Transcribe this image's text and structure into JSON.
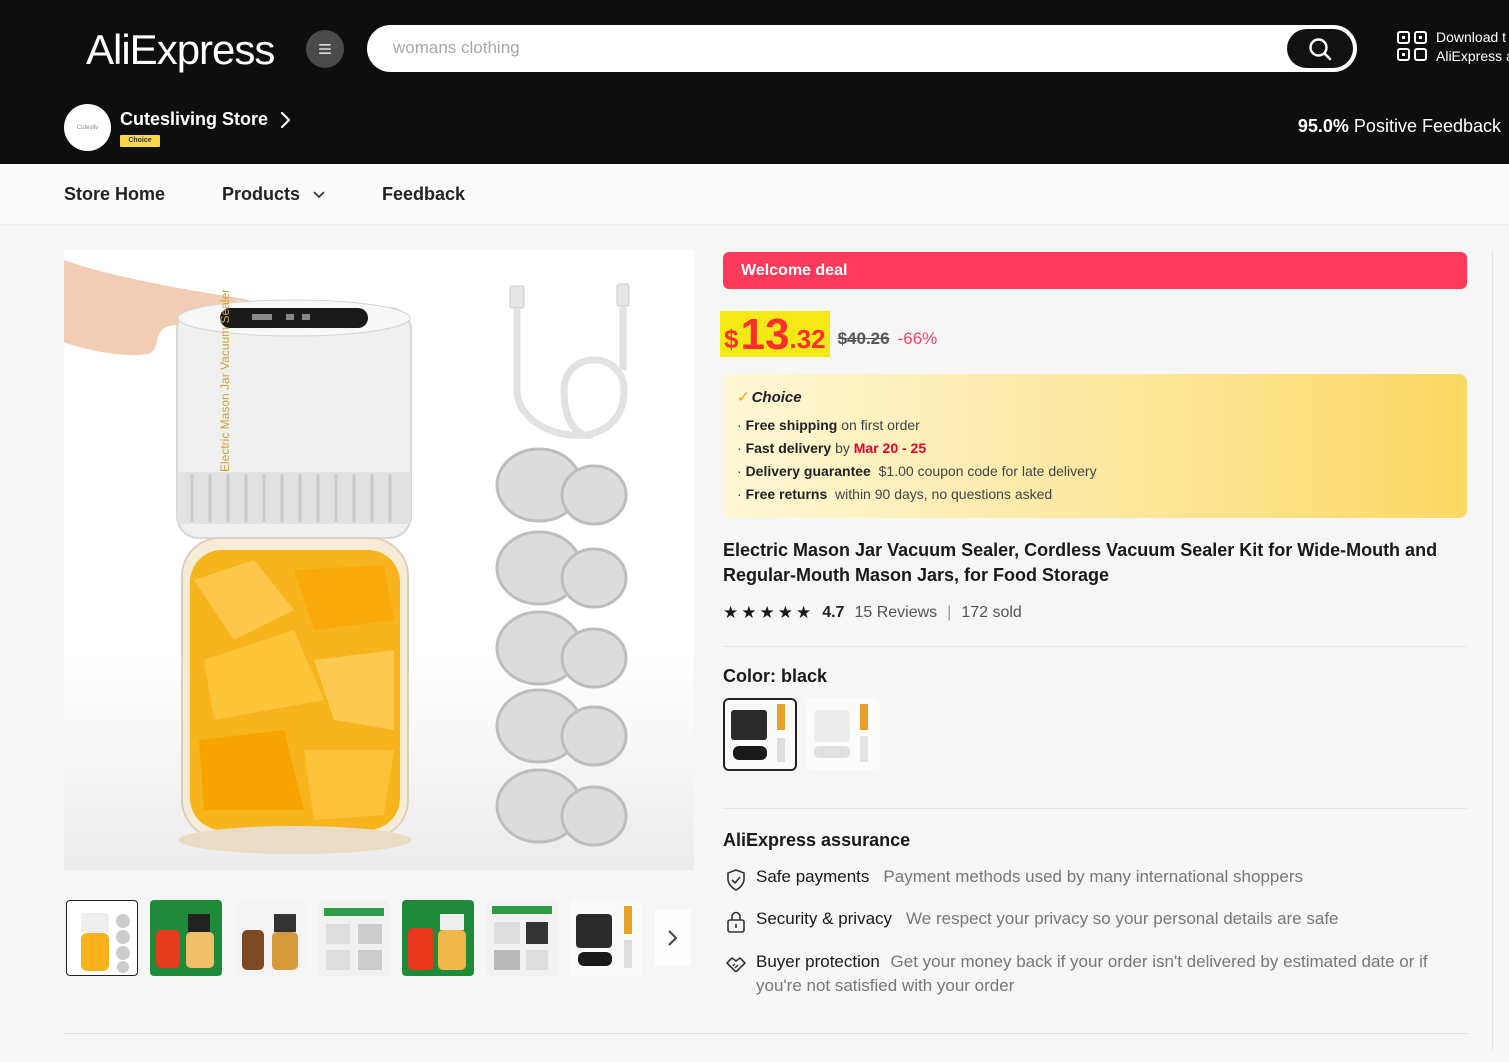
{
  "header": {
    "logo": "AliExpress",
    "search_placeholder": "womans clothing",
    "download_line1": "Download t",
    "download_line2": "AliExpress a"
  },
  "store": {
    "avatar_text": "Cutesliv",
    "name": "Cutesliving Store",
    "badge": "Choice",
    "feedback_value": "95.0%",
    "feedback_label": "Positive Feedback"
  },
  "nav": {
    "items": [
      "Store Home",
      "Products",
      "Feedback"
    ]
  },
  "deal": {
    "banner": "Welcome deal",
    "currency": "$",
    "price_int": "13",
    "price_dec": ".32",
    "original": "$40.26",
    "discount": "-66%"
  },
  "choice": {
    "title": "Choice",
    "lines": [
      {
        "bold": "Free shipping",
        "text": "on first order"
      },
      {
        "bold": "Fast delivery",
        "text": "by",
        "highlight": "Mar 20 - 25"
      },
      {
        "bold": "Delivery guarantee",
        "text": "$1.00 coupon code for late delivery"
      },
      {
        "bold": "Free returns",
        "text": "within 90 days, no questions asked"
      }
    ]
  },
  "product": {
    "title": "Electric Mason Jar Vacuum Sealer, Cordless Vacuum Sealer Kit for Wide-Mouth and Regular-Mouth Mason Jars, for Food Storage",
    "stars": "★★★★★",
    "rating": "4.7",
    "reviews": "15 Reviews",
    "separator": "|",
    "sold": "172 sold",
    "color_label": "Color: black",
    "jar_label": "Electric Mason Jar Vacuum Sealer"
  },
  "assurance": {
    "title": "AliExpress assurance",
    "items": [
      {
        "label": "Safe payments",
        "desc": "Payment methods used by many international shoppers",
        "icon": "shield-check-icon"
      },
      {
        "label": "Security & privacy",
        "desc": "We respect your privacy so your personal details are safe",
        "icon": "lock-icon"
      },
      {
        "label": "Buyer protection",
        "desc": "Get your money back if your order isn't delivered by estimated date or if you're not satisfied with your order",
        "icon": "handshake-icon"
      }
    ]
  },
  "colors": {
    "header_bg": "#0e0e0e",
    "deal_red": "#fd3a5c",
    "price_red": "#ff2e2e",
    "highlight_yellow": "#f4e915",
    "discount_pink": "#f04467",
    "choice_yellow": "#fde79b"
  }
}
